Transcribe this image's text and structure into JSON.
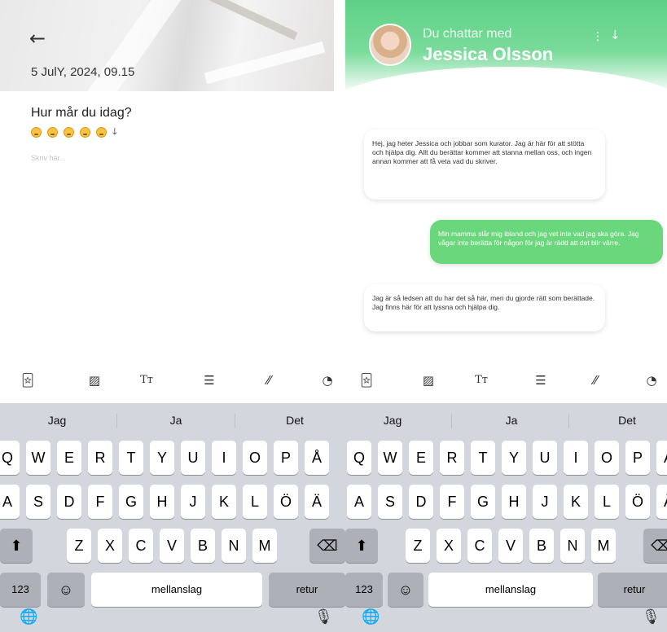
{
  "journal": {
    "back_icon": "arrow-left-icon",
    "date": "5 JulY, 2024, 09.15",
    "question": "Hur mår du idag?",
    "mood_count": 5,
    "mood_more_icon": "arrow-down-icon",
    "placeholder": "Skriv här..."
  },
  "chat": {
    "subtitle": "Du chattar med",
    "name": "Jessica Olsson",
    "messages": [
      {
        "sender": "counselor",
        "text": "Hej, jag heter Jessica och jobbar som kurator. Jag är här för att stötta och hjälpa dig. Allt du berättar kommer att stanna mellan oss, och ingen annan kommer att få veta vad du skriver."
      },
      {
        "sender": "user",
        "text": "Min mamma slår mig ibland och jag vet inte vad jag ska göra. Jag vågar inte berätta för någon för jag är rädd att det blir värre."
      },
      {
        "sender": "counselor",
        "text": "Jag är så ledsen att du har det så här, men du gjorde rätt som berättade. Jag finns här för att lyssna och hjälpa dig."
      }
    ]
  },
  "toolbar": {
    "icons": [
      "sticker-icon",
      "image-icon",
      "text-format-icon",
      "list-icon",
      "strikethrough-icon",
      "timer-icon"
    ]
  },
  "keyboard": {
    "suggestions": [
      "Jag",
      "Ja",
      "Det"
    ],
    "row1": [
      "Q",
      "W",
      "E",
      "R",
      "T",
      "Y",
      "U",
      "I",
      "O",
      "P",
      "Å"
    ],
    "row2": [
      "A",
      "S",
      "D",
      "F",
      "G",
      "H",
      "J",
      "K",
      "L",
      "Ö",
      "Ä"
    ],
    "row3": [
      "Z",
      "X",
      "C",
      "V",
      "B",
      "N",
      "M"
    ],
    "numbers_label": "123",
    "space_label": "mellanslag",
    "return_label": "retur"
  },
  "colors": {
    "accent_green": "#6bd77c",
    "keyboard_bg": "#d4d6dd"
  }
}
